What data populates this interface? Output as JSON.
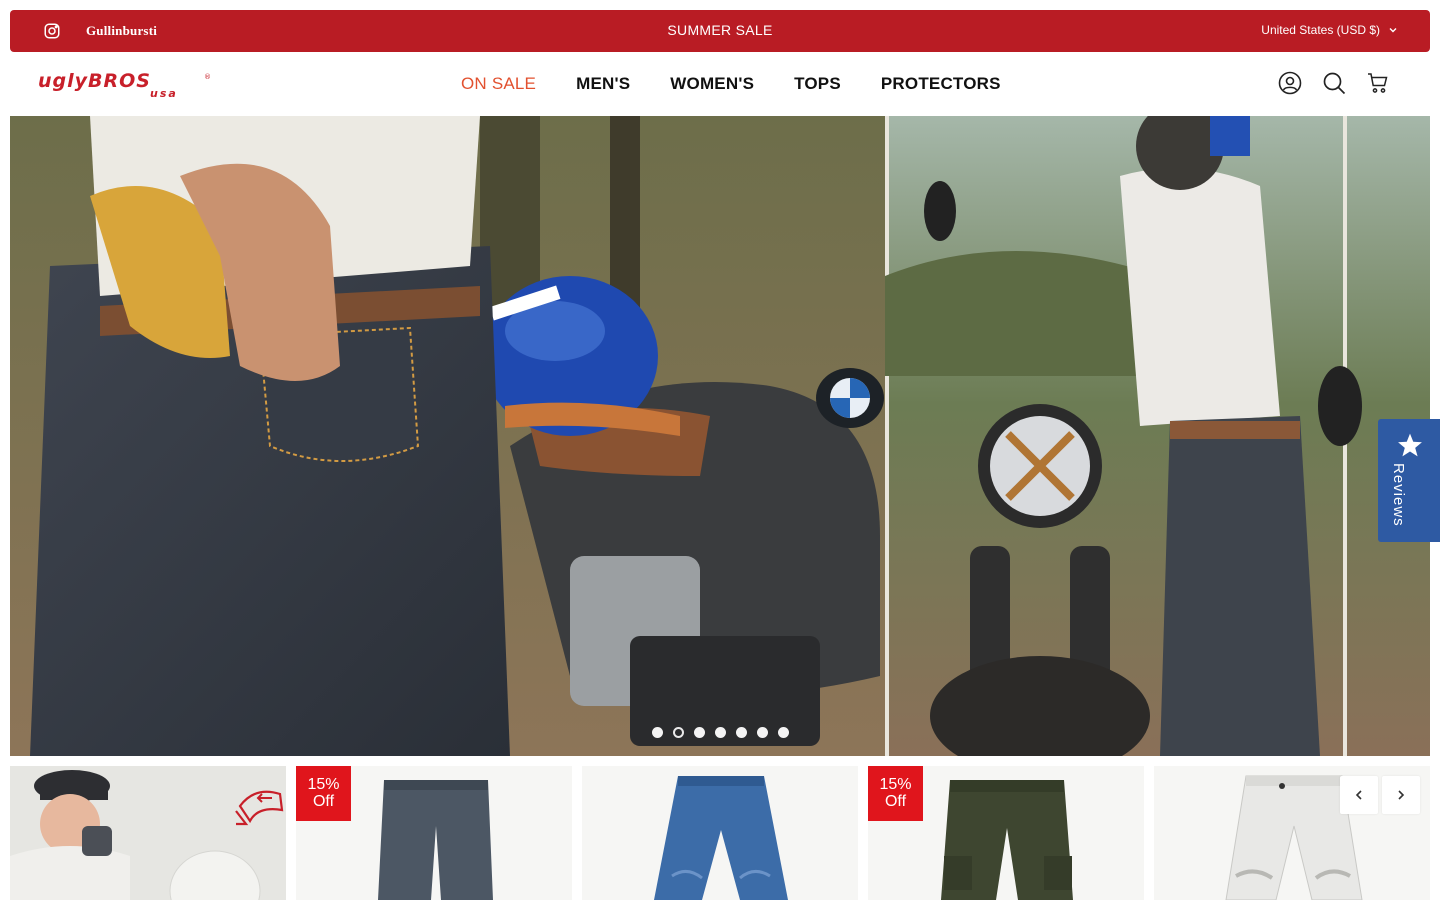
{
  "announcement": {
    "text": "SUMMER SALE",
    "brand": "Gullinbursti",
    "currency": "United States (USD $)"
  },
  "header": {
    "logo_text": "uglyBROS usa",
    "nav": [
      {
        "label": "ON SALE"
      },
      {
        "label": "MEN'S"
      },
      {
        "label": "WOMEN'S"
      },
      {
        "label": "TOPS"
      },
      {
        "label": "PROTECTORS"
      }
    ]
  },
  "hero": {
    "slides_count": 7,
    "active_slide": 2
  },
  "reviews_tab": {
    "label": "Reviews"
  },
  "products": [
    {
      "type": "promo"
    },
    {
      "badge": "15%\nOff"
    },
    {
      "badge": ""
    },
    {
      "badge": "15%\nOff"
    },
    {
      "badge": ""
    }
  ],
  "badges": {
    "line1": "15%",
    "line2": "Off"
  },
  "colors": {
    "brand_red": "#b91c24",
    "sale_orange": "#e2512f",
    "badge_red": "#e0151c",
    "reviews_blue": "#2e5aa3"
  }
}
